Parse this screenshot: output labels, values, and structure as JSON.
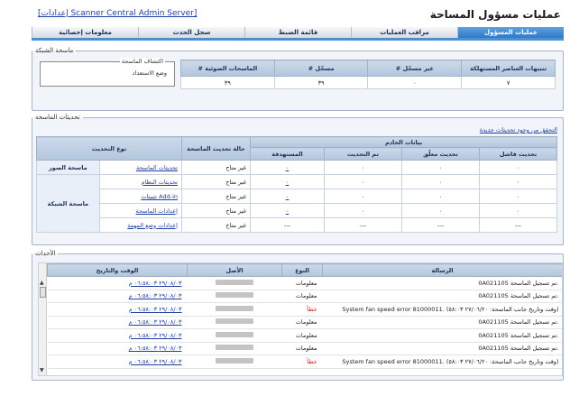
{
  "app": {
    "title": "عمليات مسؤول المساحة",
    "header_link": "[إعدادات Scanner Central Admin Server]"
  },
  "tabs": [
    {
      "label": "عمليات المسؤول",
      "active": true
    },
    {
      "label": "مراقب العمليات",
      "active": false
    },
    {
      "label": "قائمة الضبط",
      "active": false
    },
    {
      "label": "سجل الحدث",
      "active": false
    },
    {
      "label": "معلومات إحصائية",
      "active": false
    }
  ],
  "scanner_section": {
    "legend": "ماسحة الشبكة",
    "headers": {
      "virtual": "# الماسحات الضوئية",
      "registered": "# مسجّل",
      "unregistered": "# غير مسجّل",
      "consumable_alerts": "تنبيهات العناصر المستهلكة"
    },
    "values": {
      "virtual": "٣٩",
      "registered": "٣٩",
      "unregistered": "٠",
      "consumable_alerts": "٧"
    },
    "discovery": {
      "legend": "اكتشاف الماسحة",
      "status": "وضع الاستعداد"
    }
  },
  "updates_section": {
    "legend": "تحديثات الماسحة",
    "check_link": "التحقق من وجود تحديثات جديدة",
    "headers": {
      "update_type": "نوع التحديث",
      "status": "حالة تحديث الماسحة",
      "target_data": "بيانات الخادم",
      "targeted": "المستهدفة",
      "updated": "تم التحديث",
      "pending": "تحديث معلّق",
      "failed": "تحديث فاشل"
    },
    "groups": {
      "image": "ماسحة الصور",
      "network": "ماسحة الشبكة"
    },
    "rows": [
      {
        "type": "تحديثات الماسحة",
        "status": "غير متاح",
        "targeted": "٠",
        "updated": "٠",
        "pending": "٠",
        "failed": "٠"
      },
      {
        "type": "تحديثات النظام",
        "status": "غير متاح",
        "targeted": "٠",
        "updated": "٠",
        "pending": "٠",
        "failed": "٠"
      },
      {
        "type": "تثبيتات Add-in",
        "status": "غير متاح",
        "targeted": "٠",
        "updated": "٠",
        "pending": "٠",
        "failed": "٠"
      },
      {
        "type": "إعدادات الماسحة",
        "status": "غير متاح",
        "targeted": "٠",
        "updated": "٠",
        "pending": "٠",
        "failed": "٠"
      },
      {
        "type": "إعدادات وضع المهمة",
        "status": "غير متاح",
        "targeted": "---",
        "updated": "---",
        "pending": "---",
        "failed": "---"
      }
    ]
  },
  "events_section": {
    "legend": "الأحداث",
    "headers": {
      "datetime": "الوقت والتاريخ",
      "source": "الأصل",
      "type": "النوع",
      "message": "الرسالة"
    },
    "rows": [
      {
        "datetime": "٢٩/٠٨/٠٣ ٠٦:٥٨:٠٣ م",
        "type": "معلومات",
        "is_error": false,
        "message": "0A021105 تم تسجيل الماسحة."
      },
      {
        "datetime": "٢٩/٠٨/٠٣ ٠٦:٥٨:٠٣ م",
        "type": "معلومات",
        "is_error": false,
        "message": "0A021105 تم تسجيل الماسحة."
      },
      {
        "datetime": "٢٩/٠٨/٠٣ ٠٦:٥٨:٠٣ م",
        "type": "خطأ",
        "is_error": true,
        "message": "System fan speed error 81000011. (وقت وتاريخ جانب الماسحة: ٢٧/٠٦/٢٠ ٥٨:٠٣)"
      },
      {
        "datetime": "٢٩/٠٨/٠٣ ٠٦:٥٨:٠٣ م",
        "type": "معلومات",
        "is_error": false,
        "message": "0A021105 تم تسجيل الماسحة."
      },
      {
        "datetime": "٢٩/٠٨/٠٣ ٠٦:٥٨:٠٣ م",
        "type": "معلومات",
        "is_error": false,
        "message": "0A021105 تم تسجيل الماسحة."
      },
      {
        "datetime": "٢٩/٠٨/٠٣ ٠٦:٥٨:٠٣ م",
        "type": "معلومات",
        "is_error": false,
        "message": "0A021105 تم تسجيل الماسحة."
      },
      {
        "datetime": "٢٩/٠٨/٠٣ ٠٦:٥٨:٠٣ م",
        "type": "خطأ",
        "is_error": true,
        "message": "System fan speed error 81000011. (وقت وتاريخ جانب الماسحة: ٢٧/٠٦/٢٠ ٥٨:٠٣)"
      }
    ]
  },
  "icons": {
    "scroll_up": "scroll-up-arrow-icon",
    "scroll_down": "scroll-down-arrow-icon"
  },
  "colors": {
    "accent": "#2f78c4",
    "error": "#d42020",
    "link": "#1f3fa0"
  }
}
